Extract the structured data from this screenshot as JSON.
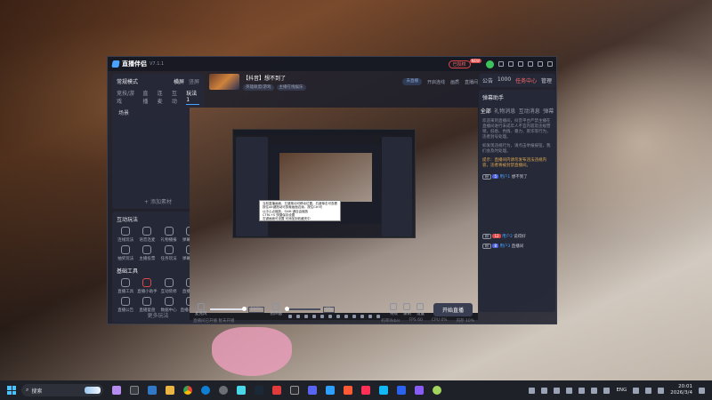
{
  "app": {
    "name": "直播伴侣",
    "version": "V7.1.1",
    "login_status": "已授权",
    "new_badge": "NEW"
  },
  "left_panel": {
    "scene_header": "常规模式",
    "scene_tabs": [
      "横屏",
      "竖屏"
    ],
    "source_tabs": [
      "竞技/游戏",
      "直播",
      "连麦",
      "互动",
      "玩法1"
    ],
    "scene_items": [
      "场景"
    ],
    "add_source": "+ 添加素材",
    "interactive_title": "互动玩法",
    "interactive_items": [
      "连线玩法",
      "语音连麦",
      "礼物播报",
      "弹幕互动",
      "抽奖玩法",
      "主播投票",
      "任务玩法",
      "弹幕互动"
    ],
    "tools_title": "基础工具",
    "tools_items": [
      "直播工具",
      "直播小助手",
      "互动装修",
      "直播计划",
      "直播公告",
      "直播复盘",
      "数据中心",
      "直播间设置"
    ],
    "more": "更多玩法"
  },
  "stream_header": {
    "title": "【抖音】想不到了",
    "tags": [
      "英雄联盟/游戏",
      "主播在线娱乐"
    ],
    "right_tag": "去直播",
    "right_items": [
      "开启连线",
      "画质",
      "直播间"
    ]
  },
  "preview": {
    "tooltip_lines": [
      "当前直播画面，左键拖动可移动位置。右键单击可查看",
      "按住Alt键拖动可剪裁画面边缘，按住Ctrl可",
      "以中心点缩放，Shift 键自由缩放",
      "CTRL+S 快捷保存设置",
      "右键画面可设置 可添加到收藏夹中"
    ]
  },
  "controls": {
    "mic_label": "麦克风",
    "mic_pct": "100%",
    "speaker_label": "扬声器",
    "speaker_pct": "0%",
    "icons": [
      "特效",
      "录制",
      "设置"
    ],
    "go_live": "开始直播"
  },
  "status_bar": {
    "left": "直播间已开播 暂未开播",
    "items": [
      "码率0kb/s",
      "FPS 60",
      "CPU 0%",
      "内存 10%"
    ]
  },
  "right_panel": {
    "tabs": [
      "公告",
      "1000",
      "任务中心",
      "管理"
    ],
    "helper_title": "弹幕助手",
    "sub_tabs": [
      "全部",
      "礼物消息",
      "互动消息",
      "弹幕"
    ],
    "system_messages": [
      "欢迎来到直播间，抖音平台严禁主播在直播间进行未成年人不宜内容及违规营销，低俗、色情、暴力、欺诈等行为，违者封号处理。",
      "如发现违规行为，请点击举报按钮，我们会及时处理。"
    ],
    "chat_messages": [
      {
        "name": "用户1",
        "text": "想不到了",
        "level": "5"
      },
      {
        "name": "用户2",
        "text": "说得好",
        "level": "12"
      },
      {
        "name": "用户3",
        "text": "直播间",
        "level": "8"
      }
    ],
    "notice": "提示：直播间内请勿发布违法违规内容，违者将被封禁直播间。"
  },
  "taskbar": {
    "search_placeholder": "搜索",
    "lang": "ENG",
    "time": "20:01",
    "date": "2026/3/4"
  },
  "colors": {
    "accent": "#4aa3ff",
    "danger": "#e04848",
    "panel": "#262938"
  }
}
